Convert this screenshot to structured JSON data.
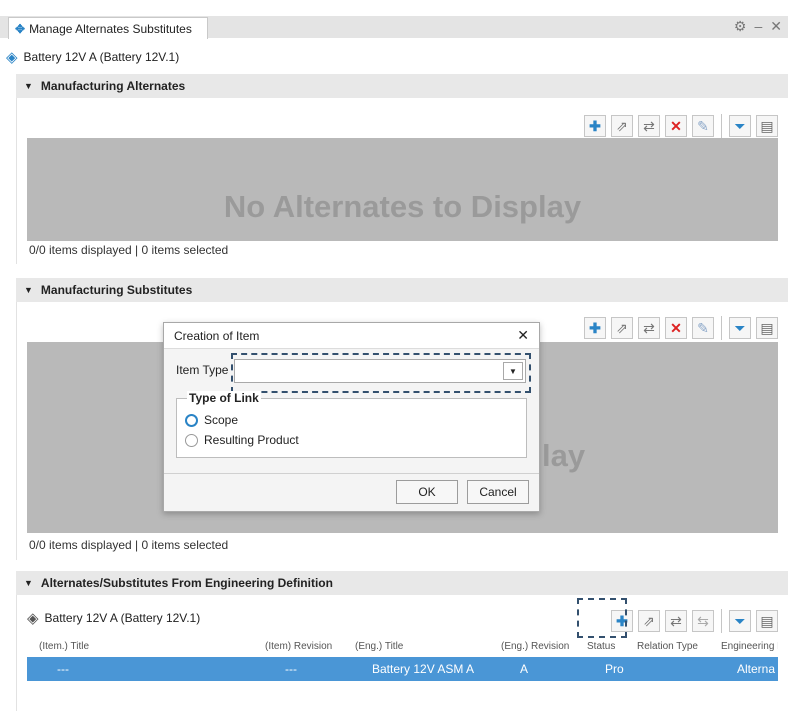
{
  "window": {
    "tab_title": "Manage Alternates Substitutes",
    "gear_icon": "gear-icon",
    "minimize": "–",
    "close": "✕"
  },
  "object": {
    "label": "Battery 12V A (Battery 12V.1)"
  },
  "alternates": {
    "title": "Manufacturing Alternates",
    "empty_text": "No Alternates to Display",
    "status": "0/0 items displayed | 0 items selected"
  },
  "substitutes": {
    "title": "Manufacturing Substitutes",
    "empty_text_partial": "lay",
    "status": "0/0 items displayed | 0 items selected"
  },
  "dialog": {
    "title": "Creation of Item",
    "item_type_label": "Item Type",
    "item_type_value": "",
    "type_of_link_legend": "Type of Link",
    "options": [
      "Scope",
      "Resulting Product"
    ],
    "selected_option": "Scope",
    "ok_label": "OK",
    "cancel_label": "Cancel"
  },
  "eng_def": {
    "title": "Alternates/Substitutes From Engineering Definition",
    "object_label": "Battery 12V A (Battery 12V.1)",
    "columns": [
      "(Item.) Title",
      "(Item) Revision",
      "(Eng.) Title",
      "(Eng.) Revision",
      "Status",
      "Relation Type",
      "Engineering F"
    ],
    "row": [
      "---",
      "---",
      "Battery 12V ASM A",
      "A",
      "Pro",
      "",
      "Alterna"
    ]
  },
  "colors": {
    "accent": "#2a84c6",
    "selected_row": "#4a96d6",
    "empty_area": "#b9b9b9"
  }
}
